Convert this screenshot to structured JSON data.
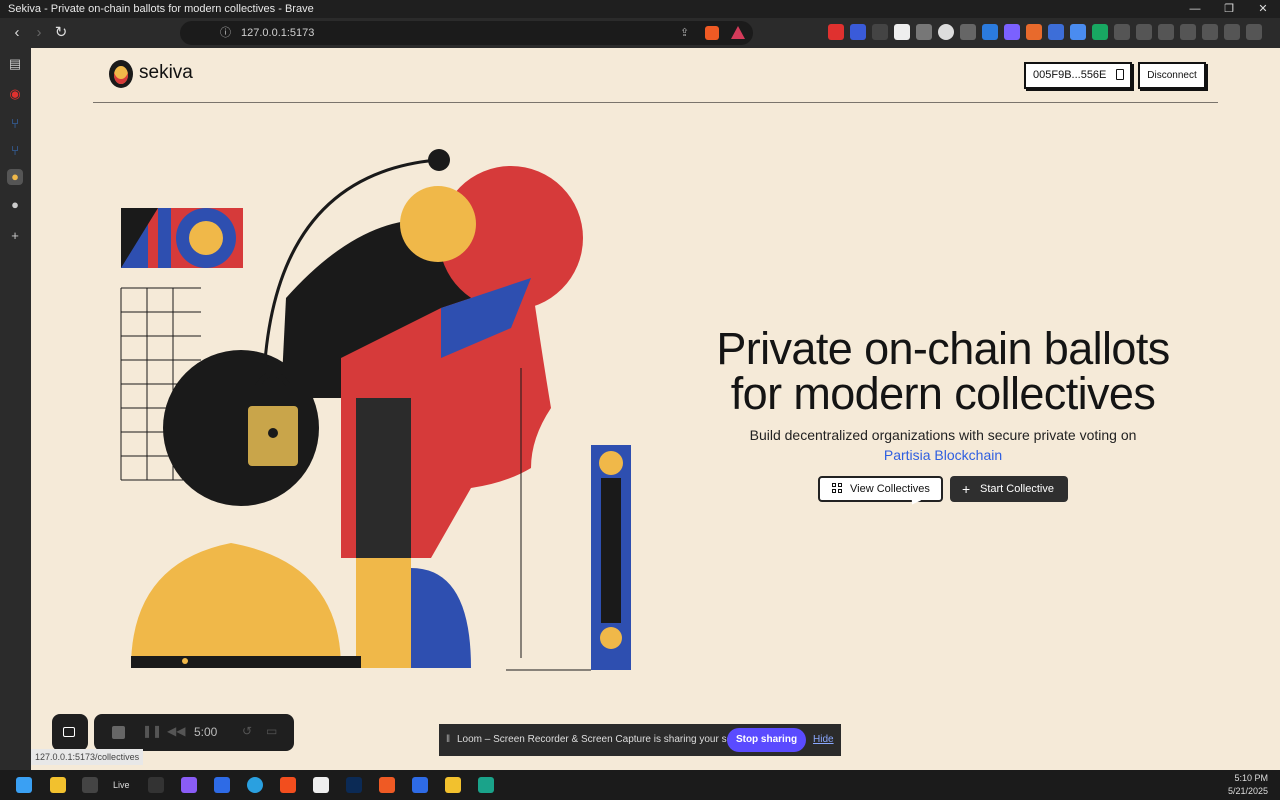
{
  "window": {
    "title": "Sekiva - Private on-chain ballots for modern collectives - Brave",
    "controls": [
      "—",
      "❐",
      "✕"
    ]
  },
  "browser": {
    "url": "127.0.0.1:5173",
    "status_url": "127.0.0.1:5173/collectives"
  },
  "header": {
    "logo_text": "sekiva",
    "wallet_address": "005F9B...556E",
    "disconnect_label": "Disconnect"
  },
  "hero": {
    "title_line1": "Private on-chain ballots",
    "title_line2": "for modern collectives",
    "subtitle": "Build decentralized organizations with secure private voting on",
    "link_text": "Partisia Blockchain",
    "view_button": "View Collectives",
    "start_button": "Start Collective"
  },
  "recorder": {
    "time": "5:00"
  },
  "share_banner": {
    "text": "Loom – Screen Recorder & Screen Capture is sharing your screen.",
    "stop_label": "Stop sharing",
    "hide_label": "Hide"
  },
  "taskbar": {
    "live_label": "Live",
    "time": "5:10 PM",
    "date": "5/21/2025"
  },
  "colors": {
    "page_bg": "#f5ead8",
    "accent_red": "#d63a3a",
    "accent_yellow": "#f0b849",
    "accent_blue": "#2e4fb0",
    "link_blue": "#2f5fe0",
    "loom_purple": "#5a4bff"
  }
}
